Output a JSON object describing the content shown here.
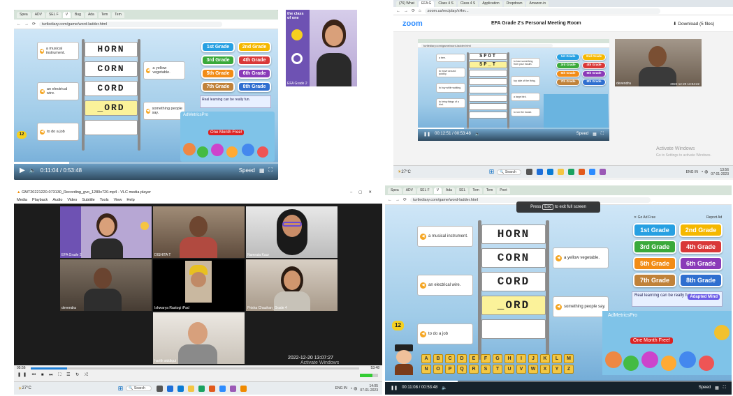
{
  "game": {
    "clues": [
      "a musical instrument.",
      "a yellow vegetable.",
      "an electrical wire.",
      "something people say.",
      "to do a job"
    ],
    "words": [
      "HORN",
      "CORN",
      "CORD",
      "_ORD",
      ""
    ],
    "grades": [
      "1st Grade",
      "2nd Grade",
      "3rd Grade",
      "4th Grade",
      "5th Grade",
      "6th Grade",
      "7th Grade",
      "8th Grade"
    ],
    "adfree": "Go Ad Free",
    "report": "Report Ad",
    "promo": "Real learning can be really fun.",
    "promo_badge": "Adapted Mind",
    "adbrand": "AdMetricsPro",
    "one_month": "One Month Free!",
    "level": "12",
    "keys": [
      "A",
      "B",
      "C",
      "D",
      "E",
      "F",
      "G",
      "H",
      "I",
      "J",
      "K",
      "L",
      "M",
      "N",
      "O",
      "P",
      "Q",
      "R",
      "S",
      "T",
      "U",
      "V",
      "W",
      "X",
      "Y",
      "Z"
    ]
  },
  "q1": {
    "tabs": [
      "Spea",
      "ADV",
      "SEL F",
      "V",
      "Bug",
      "Ada",
      "Tem",
      "Tem",
      "Poet"
    ],
    "url": "turtlediary.com/game/word-ladder.html",
    "time": "0:11:04 / 0:53:48",
    "speed": "Speed",
    "side_name": "EFA Grade 2",
    "side_brand": "the class of one"
  },
  "q2": {
    "tabs": [
      "(76) What",
      "EFA G",
      "Class 4 S",
      "Class 4 S",
      "Application",
      "Dropdown",
      "Amazon.in"
    ],
    "url": "zoom.us/rec/play/xHm...",
    "zoom_logo": "zoom",
    "title": "EFA Grade 2's Personal Meeting Room",
    "download": "Download (5 files)",
    "spot": "SPOT",
    "spot2": "SP_T",
    "time": "00:12:51 / 00:53:48",
    "speed": "Speed",
    "clues": [
      "a tree.",
      "to lose something from your mouth.",
      "to move around quickly.",
      "top side of the thing.",
      "to buy while walking.",
      "a large bird.",
      "to bring things of a bird.",
      "to run the house."
    ],
    "cam_date": "2022-12-20 13:04:22",
    "cam_name": "devendra",
    "activate1": "Activate Windows",
    "activate2": "Go to Settings to activate Windows.",
    "temp": "27°C",
    "search": "Search",
    "lang": "ENG IN",
    "clock1": "13:56",
    "clock2": "07-01-2023"
  },
  "q3": {
    "title": "GMT20221220-073130_Recording_gvo_1280x720.mp4 - VLC media player",
    "menu": [
      "Media",
      "Playback",
      "Audio",
      "Video",
      "Subtitle",
      "Tools",
      "View",
      "Help"
    ],
    "tiles": [
      {
        "name": "EFA Grade 2"
      },
      {
        "name": "DISHITA T"
      },
      {
        "name": "Namrata Kaur"
      },
      {
        "name": "devendra"
      },
      {
        "name": "Ishwarya Rastogi iPad"
      },
      {
        "name": "Prisha Chauhan_Grade 4"
      },
      {
        "name": "harith siddiqui"
      }
    ],
    "timestamp": "2022-12-20 13:07:27",
    "time_left": "05:56",
    "time_right": "53:48",
    "activate1": "Activate Windows",
    "activate2": "Go to Settings to activate Windows.",
    "temp": "27°C",
    "search": "Search",
    "lang": "ENG IN",
    "clock1": "14:05",
    "clock2": "07-01-2023"
  },
  "q4": {
    "tabs": [
      "Spea",
      "ADV",
      "SEL F",
      "V",
      "Ada",
      "SEL",
      "Tem",
      "Tem",
      "Poet"
    ],
    "url": "turtlediary.com/game/word-ladder.html",
    "fullscreen_pre": "Press",
    "fullscreen_key": "Esc",
    "fullscreen_post": "to exit full screen",
    "time": "00:11:08 / 00:53:48",
    "speed": "Speed"
  },
  "colors": {
    "zoom_blue": "#2d8cff",
    "ladder_highlight": "#fbf29a",
    "vlc_orange": "#f08a00"
  }
}
